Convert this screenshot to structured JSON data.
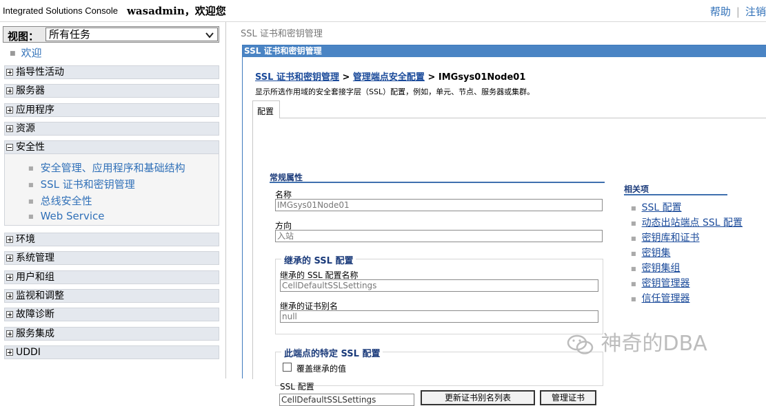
{
  "header": {
    "brand": "Integrated Solutions Console",
    "welcome": "wasadmin，欢迎您",
    "help": "帮助",
    "logout": "注销"
  },
  "nav": {
    "view_label": "视图：",
    "view_value": "所有任务",
    "welcome": "欢迎",
    "categories": [
      {
        "label": "指导性活动"
      },
      {
        "label": "服务器"
      },
      {
        "label": "应用程序"
      },
      {
        "label": "资源"
      },
      {
        "label": "安全性"
      },
      {
        "label": "环境"
      },
      {
        "label": "系统管理"
      },
      {
        "label": "用户和组"
      },
      {
        "label": "监视和调整"
      },
      {
        "label": "故障诊断"
      },
      {
        "label": "服务集成"
      },
      {
        "label": "UDDI"
      }
    ],
    "security_items": [
      {
        "label": "安全管理、应用程序和基础结构"
      },
      {
        "label": "SSL 证书和密钥管理"
      },
      {
        "label": "总线安全性"
      },
      {
        "label": "Web Service"
      }
    ]
  },
  "main": {
    "top_crumb": "SSL 证书和密钥管理",
    "panel_title": "SSL 证书和密钥管理",
    "breadcrumbs": {
      "link1": "SSL 证书和密钥管理",
      "sep": " > ",
      "link2": "管理端点安全配置",
      "current": "IMGsys01Node01"
    },
    "description": "显示所选作用域的安全套接字层（SSL）配置，例如，单元、节点、服务器或集群。",
    "tab": "配置",
    "general": {
      "heading": "常规属性",
      "name_label": "名称",
      "name_value": "IMGsys01Node01",
      "direction_label": "方向",
      "direction_value": "入站"
    },
    "inherited": {
      "heading": "继承的 SSL 配置",
      "config_label": "继承的 SSL 配置名称",
      "config_value": "CellDefaultSSLSettings",
      "alias_label": "继承的证书别名",
      "alias_value": "null"
    },
    "specific": {
      "heading": "此端点的特定 SSL 配置",
      "override_label": "覆盖继承的值",
      "override_checked": false,
      "ssl_config_label": "SSL 配置",
      "ssl_config_value": "CellDefaultSSLSettings",
      "update_button": "更新证书别名列表",
      "manage_button": "管理证书"
    },
    "related": {
      "heading": "相关项",
      "links": [
        {
          "label": "SSL 配置"
        },
        {
          "label": "动态出站端点 SSL 配置"
        },
        {
          "label": "密钥库和证书"
        },
        {
          "label": "密钥集"
        },
        {
          "label": "密钥集组"
        },
        {
          "label": "密钥管理器"
        },
        {
          "label": "信任管理器"
        }
      ]
    }
  },
  "watermark": "神奇的DBA",
  "colors": {
    "link": "#3070b8",
    "panel_title_bg": "#4a84c4",
    "section_heading": "#1a3a7a",
    "nav_category_bg": "#e4e8ee"
  }
}
